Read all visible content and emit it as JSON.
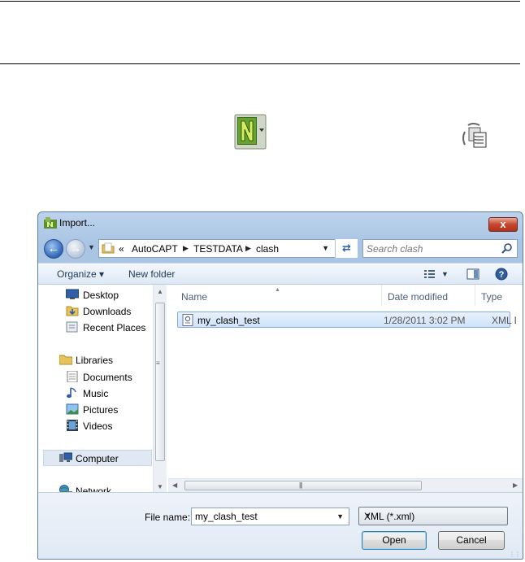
{
  "dialog": {
    "title": "Import...",
    "close_label": "x",
    "address": {
      "overflow": "«",
      "crumbs": [
        "AutoCAPT",
        "TESTDATA",
        "clash"
      ],
      "search_placeholder": "Search clash"
    },
    "toolbar": {
      "organize_label": "Organize ▾",
      "new_folder_label": "New folder"
    },
    "nav": {
      "favorites": [
        "Desktop",
        "Downloads",
        "Recent Places"
      ],
      "libraries_label": "Libraries",
      "libraries": [
        "Documents",
        "Music",
        "Pictures",
        "Videos"
      ],
      "computer_label": "Computer",
      "network_label": "Network"
    },
    "columns": {
      "name": "Name",
      "date": "Date modified",
      "type": "Type"
    },
    "files": [
      {
        "name": "my_clash_test",
        "date": "1/28/2011 3:02 PM",
        "type": "XML Document"
      }
    ],
    "file_name_label": "File name:",
    "file_name_value": "my_clash_test",
    "file_type": "XML (*.xml)",
    "open_label": "Open",
    "cancel_label": "Cancel"
  },
  "icons": [
    "navisworks-app-icon",
    "clash-detective-icon",
    "search-icon",
    "folder-icon",
    "back-arrow-icon",
    "forward-arrow-icon",
    "refresh-icon",
    "views-icon",
    "preview-pane-icon",
    "help-icon",
    "xml-file-icon"
  ],
  "colors": {
    "titlebar": "#a9c4e4",
    "close": "#c7462e",
    "selection": "#cfe3fa"
  }
}
